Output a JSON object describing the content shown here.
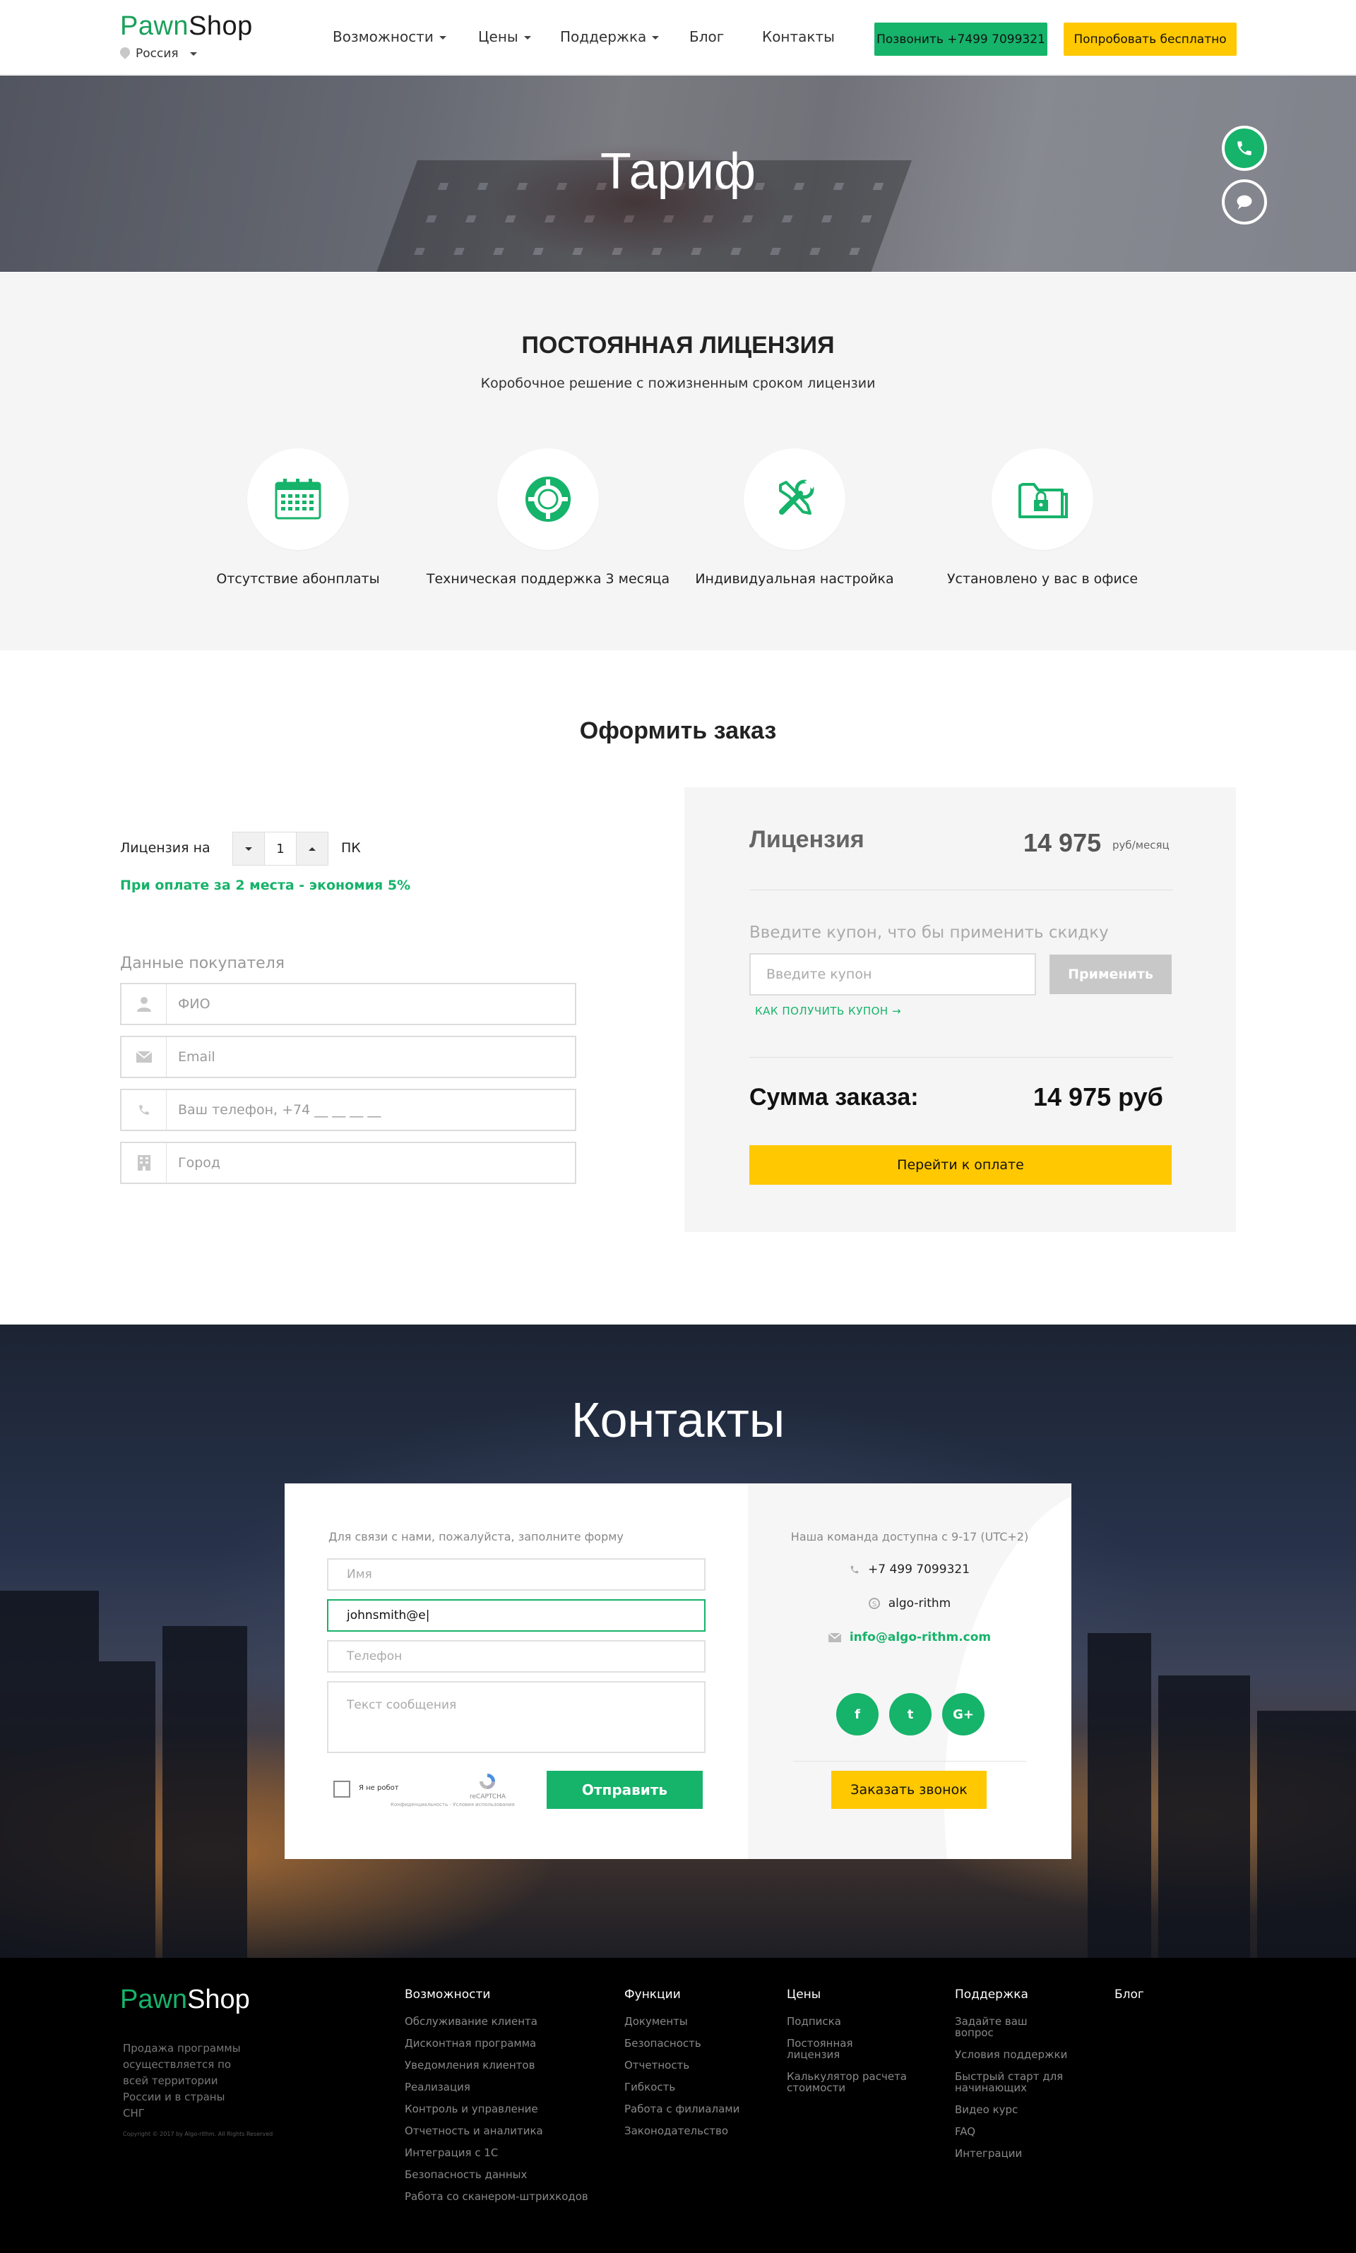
{
  "header": {
    "logo_pawn": "Pawn",
    "logo_shop": "Shop",
    "region": "Россия",
    "nav": [
      {
        "label": "Возможности"
      },
      {
        "label": "Цены"
      },
      {
        "label": "Поддержка"
      },
      {
        "label": "Блог"
      },
      {
        "label": "Контакты"
      }
    ],
    "call_button": "Позвонить +7499 7099321",
    "try_button": "Попробовать бесплатно"
  },
  "hero": {
    "title": "Тариф"
  },
  "license": {
    "title": "ПОСТОЯННАЯ ЛИЦЕНЗИЯ",
    "subtitle": "Коробочное решение с пожизненным сроком лицензии",
    "features": [
      {
        "label": "Отсутствие абонплаты",
        "icon": "calendar-icon"
      },
      {
        "label": "Техническая поддержка 3 месяца",
        "icon": "lifebuoy-icon"
      },
      {
        "label": "Индивидуальная настройка",
        "icon": "tools-icon"
      },
      {
        "label": "Установлено у вас в офисе",
        "icon": "folder-lock-icon"
      }
    ]
  },
  "order": {
    "title": "Оформить заказ",
    "license_label": "Лицензия на",
    "quantity": "1",
    "unit": "ПК",
    "promo": "При оплате за 2 места - экономия 5%",
    "buyer_heading": "Данные покупателя",
    "fields": [
      {
        "placeholder": "ФИО",
        "icon": "user-icon"
      },
      {
        "placeholder": "Email",
        "icon": "mail-icon"
      },
      {
        "placeholder": "Ваш телефон, +74 __ __ __ __",
        "icon": "phone-icon"
      },
      {
        "placeholder": "Город",
        "icon": "building-icon"
      }
    ],
    "summary": {
      "license": "Лицензия",
      "price": "14 975",
      "price_unit": "руб/месяц",
      "coupon_prompt": "Введите купон, что бы применить скидку",
      "coupon_placeholder": "Введите купон",
      "apply": "Применить",
      "how_to_get": "КАК ПОЛУЧИТЬ КУПОН →",
      "total_label": "Сумма заказа:",
      "total": "14 975 руб",
      "pay": "Перейти к оплате"
    }
  },
  "contacts": {
    "title": "Контакты",
    "form_lead": "Для связи с нами, пожалуйста, заполните форму",
    "name_placeholder": "Имя",
    "email_value": "johnsmith@e",
    "phone_placeholder": "Телефон",
    "message_placeholder": "Текст сообщения",
    "captcha_label": "Я не робот",
    "captcha_brand": "reCAPTCHA",
    "captcha_footer": "Конфиденциальность - Условия использования",
    "send": "Отправить",
    "availability": "Наша команда доступна с 9-17 (UTC+2)",
    "phone": "+7 499 7099321",
    "skype": "algo-rithm",
    "email": "info@algo-rithm.com",
    "social": [
      {
        "label": "f",
        "icon": "facebook-icon"
      },
      {
        "label": "t",
        "icon": "twitter-icon"
      },
      {
        "label": "G+",
        "icon": "google-plus-icon"
      }
    ],
    "callback": "Заказать звонок"
  },
  "footer": {
    "logo_pawn": "Pawn",
    "logo_shop": "Shop",
    "about": "Продажа программы осуществляется по всей территории России и в страны СНГ",
    "copyright": "Copyright © 2017 by Algo-rithm. All Rights Reserved",
    "columns": [
      {
        "title": "Возможности",
        "items": [
          "Обслуживание клиента",
          "Дисконтная программа",
          "Уведомления клиентов",
          "Реализация",
          "Контроль и управление",
          "Отчетность и аналитика",
          "Интеграция с 1С",
          "Безопасность данных",
          "Работа со сканером-штрихкодов"
        ]
      },
      {
        "title": "Функции",
        "items": [
          "Документы",
          "Безопасность",
          "Отчетность",
          "Гибкость",
          "Работа с филиалами",
          "Законодательство"
        ]
      },
      {
        "title": "Цены",
        "items": [
          "Подписка",
          "Постоянная лицензия",
          "Калькулятор расчета стоимости"
        ]
      },
      {
        "title": "Поддержка",
        "items": [
          "Задайте ваш вопрос",
          "Условия поддержки",
          "Быстрый старт для начинающих",
          "Видео курс",
          "FAQ",
          "Интеграции"
        ]
      },
      {
        "title": "Блог",
        "items": []
      }
    ]
  },
  "colors": {
    "accent_green": "#16b36a",
    "accent_yellow": "#ffc800"
  }
}
